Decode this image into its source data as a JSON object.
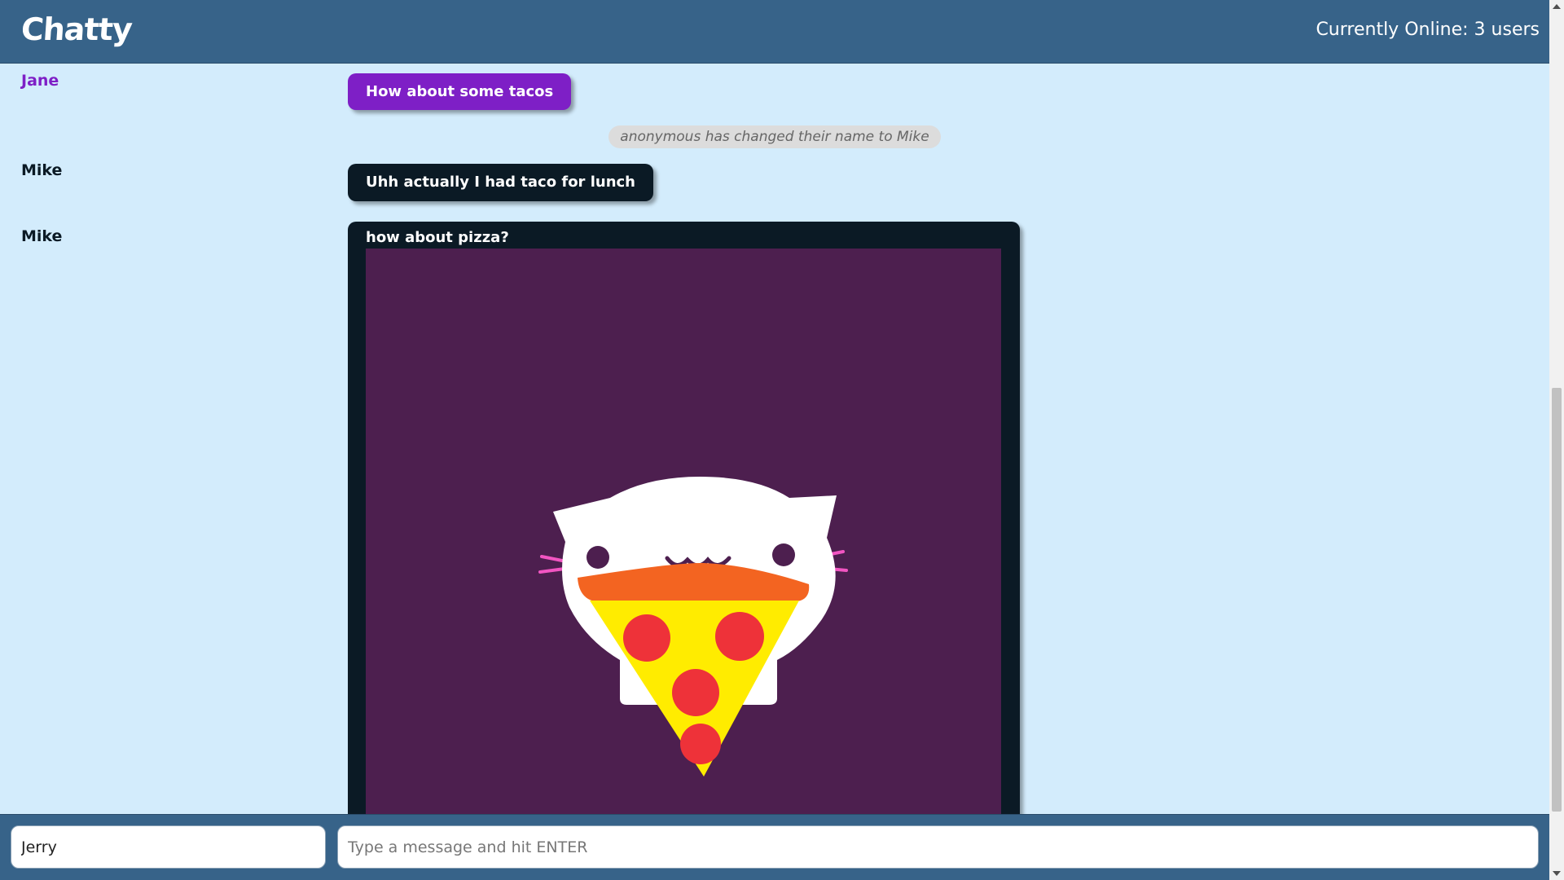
{
  "app": {
    "brand": "Chatty",
    "online_label": "Currently Online: 3 users"
  },
  "colors": {
    "navbar": "#376389",
    "background": "#d3ecfc",
    "jane": "#7e1fc6",
    "mike": "#0b1a25",
    "image_bg": "#4d1f4f"
  },
  "messages": [
    {
      "type": "user",
      "username": "Jane",
      "text": "How about some tacos",
      "color": "#7e1fc6"
    },
    {
      "type": "system",
      "text": "anonymous has changed their name to Mike"
    },
    {
      "type": "user",
      "username": "Mike",
      "text": "Uhh actually I had taco for lunch",
      "color": "#0b1a25"
    },
    {
      "type": "user",
      "username": "Mike",
      "text": "how about pizza?",
      "color": "#0b1a25",
      "image": "cat-pizza-illustration"
    }
  ],
  "footer": {
    "username_value": "Jerry",
    "message_placeholder": "Type a message and hit ENTER",
    "message_value": ""
  }
}
